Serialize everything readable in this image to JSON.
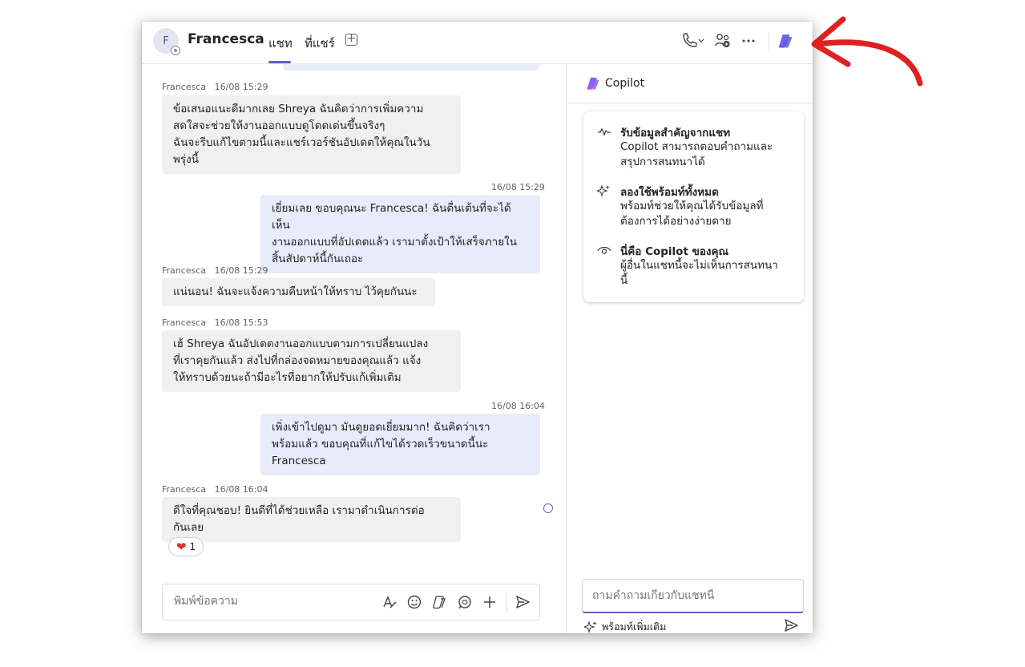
{
  "header": {
    "avatar_initial": "F",
    "contact_name": "Francesca",
    "tabs": [
      {
        "label": "แชท",
        "active": true
      },
      {
        "label": "ที่แชร์",
        "active": false
      }
    ],
    "add_tab_icon": "plus-square-icon",
    "call_icon": "phone-icon",
    "people_icon": "people-icon",
    "more_icon": "more-horizontal-icon",
    "copilot_icon": "copilot-icon"
  },
  "messages": [
    {
      "direction": "in",
      "sender": "Francesca",
      "time": "16/08 15:29",
      "text": "ข้อเสนอแนะดีมากเลย Shreya ฉันคิดว่าการเพิ่มความ\nสดใสจะช่วยให้งานออกแบบดูโดดเด่นขึ้นจริงๆ\nฉันจะรีบแก้ไขตามนี้และแชร์เวอร์ชันอัปเดตให้คุณในวัน\nพรุ่งนี้"
    },
    {
      "direction": "out",
      "time": "16/08 15:29",
      "text": "เยี่ยมเลย ขอบคุณนะ Francesca! ฉันตื่นเต้นที่จะได้เห็น\nงานออกแบบที่อัปเดตแล้ว เรามาตั้งเป้าให้เสร็จภายใน\nสิ้นสัปดาห์นี้กันเถอะ"
    },
    {
      "direction": "in",
      "sender": "Francesca",
      "time": "16/08 15:29",
      "text": "แน่นอน! ฉันจะแจ้งความคืบหน้าให้ทราบ ไว้คุยกันนะ"
    },
    {
      "direction": "in",
      "sender": "Francesca",
      "time": "16/08 15:53",
      "text": "เฮ้ Shreya ฉันอัปเดตงานออกแบบตามการเปลี่ยนแปลง\nที่เราคุยกันแล้ว ส่งไปที่กล่องจดหมายของคุณแล้ว แจ้ง\nให้ทราบด้วยนะถ้ามีอะไรที่อยากให้ปรับแก้เพิ่มเติม"
    },
    {
      "direction": "out",
      "time": "16/08 16:04",
      "text": "เพิ่งเข้าไปดูมา มันดูยอดเยี่ยมมาก! ฉันคิดว่าเรา\nพร้อมแล้ว ขอบคุณที่แก้ไขได้รวดเร็วขนาดนี้นะ\nFrancesca"
    },
    {
      "direction": "in",
      "sender": "Francesca",
      "time": "16/08 16:04",
      "text": "ดีใจที่คุณชอบ! ยินดีที่ได้ช่วยเหลือ เรามาดำเนินการต่อ\nกันเลย",
      "reaction": {
        "emoji": "❤",
        "count": "1"
      }
    }
  ],
  "composer": {
    "placeholder": "พิมพ์ข้อความ",
    "icons": [
      "format-icon",
      "emoji-icon",
      "sticker-icon",
      "loop-icon",
      "plus-icon",
      "send-icon"
    ]
  },
  "copilot": {
    "title": "Copilot",
    "features": [
      {
        "icon": "summary-wave-icon",
        "title": "รับข้อมูลสำคัญจากแชท",
        "desc": "Copilot สามารถตอบคำถามและ\nสรุปการสนทนาได้"
      },
      {
        "icon": "sparkle-icon",
        "title": "ลองใช้พร้อมท์ทั้งหมด",
        "desc": "พร้อมท์ช่วยให้คุณได้รับข้อมูลที่\nต้องการได้อย่างง่ายดาย"
      },
      {
        "icon": "eye-icon",
        "title": "นี่คือ Copilot ของคุณ",
        "desc": "ผู้อื่นในแชทนี้จะไม่เห็นการสนทนา\nนี้"
      }
    ],
    "input_placeholder": "ถามคำถามเกี่ยวกับแชทนี้",
    "more_prompts_label": "พร้อมท์เพิ่มเติม",
    "send_icon": "send-icon"
  },
  "colors": {
    "accent": "#5b5fc7",
    "outgoing_bubble": "#e8ebfa",
    "incoming_bubble": "#f0f0f0",
    "annotation_arrow": "#e02020"
  }
}
